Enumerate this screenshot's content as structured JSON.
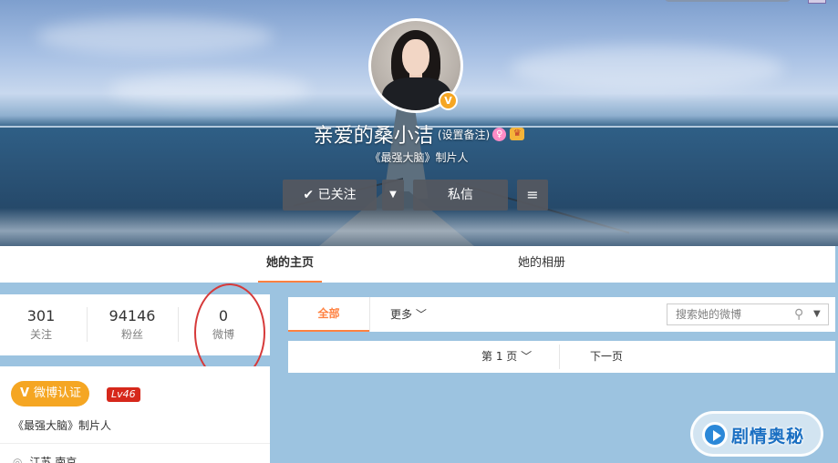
{
  "profile": {
    "name": "亲爱的桑小洁",
    "remark_link": "(设置备注)",
    "bio": "《最强大脑》制片人",
    "verify_badge": "V",
    "gender_icon": "female-icon",
    "vip_icon": "vip-icon"
  },
  "actions": {
    "follow_label": "已关注",
    "message_label": "私信",
    "dropdown_glyph": "▼",
    "menu_glyph": "≡"
  },
  "tabs": {
    "home": "她的主页",
    "album": "她的相册"
  },
  "stats": [
    {
      "value": "301",
      "label": "关注"
    },
    {
      "value": "94146",
      "label": "粉丝"
    },
    {
      "value": "0",
      "label": "微博"
    }
  ],
  "info": {
    "verify_label": "微博认证",
    "level": "Lv46",
    "description": "《最强大脑》制片人",
    "location": "江苏 南京"
  },
  "feed": {
    "tab_all": "全部",
    "more": "更多 ﹀",
    "search_placeholder": "搜索她的微博"
  },
  "pager": {
    "page": "第 1 页 ﹀",
    "next": "下一页"
  },
  "watermark": {
    "text": "剧情奥秘"
  },
  "colors": {
    "accent": "#ff8140",
    "verify": "#f5a623",
    "level_badge": "#d6281b",
    "annotation_circle": "#d63a3a"
  }
}
